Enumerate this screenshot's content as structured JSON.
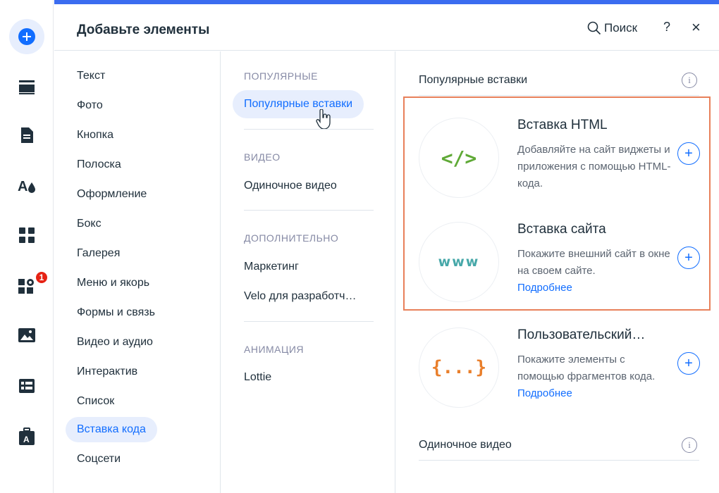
{
  "header": {
    "title": "Добавьте элементы",
    "search_label": "Поиск",
    "help_label": "?",
    "close_label": "×"
  },
  "rail": {
    "notification_count": "1",
    "icons": [
      "add-icon",
      "strip-icon",
      "page-icon",
      "theme-icon",
      "apps-grid-icon",
      "extensions-icon",
      "media-icon",
      "cms-icon",
      "portfolio-icon"
    ]
  },
  "categories": [
    {
      "label": "Текст"
    },
    {
      "label": "Фото"
    },
    {
      "label": "Кнопка"
    },
    {
      "label": "Полоска"
    },
    {
      "label": "Оформление"
    },
    {
      "label": "Бокс"
    },
    {
      "label": "Галерея"
    },
    {
      "label": "Меню и якорь"
    },
    {
      "label": "Формы и связь"
    },
    {
      "label": "Видео и аудио"
    },
    {
      "label": "Интерактив"
    },
    {
      "label": "Список"
    },
    {
      "label": "Вставка кода",
      "active": true
    },
    {
      "label": "Соцсети"
    }
  ],
  "subcategories": {
    "popular_heading": "ПОПУЛЯРНЫЕ",
    "popular_item": "Популярные вставки",
    "video_heading": "ВИДЕО",
    "video_item": "Одиночное видео",
    "extra_heading": "ДОПОЛНИТЕЛЬНО",
    "extra_item_1": "Маркетинг",
    "extra_item_2": "Velo для разработч…",
    "animation_heading": "АНИМАЦИЯ",
    "animation_item": "Lottie"
  },
  "content": {
    "section_title": "Популярные вставки",
    "section_title_2": "Одиночное видео",
    "cards": [
      {
        "icon_text": "</>",
        "title": "Вставка HTML",
        "description": "Добавляйте на сайт виджеты и приложения с помощью HTML-кода.",
        "link": ""
      },
      {
        "icon_text": "www",
        "title": "Вставка сайта",
        "description": "Покажите внешний сайт в окне на своем сайте.",
        "link": "Подробнее"
      },
      {
        "icon_text": "{...}",
        "title": "Пользовательский…",
        "description": "Покажите элементы с помощью фрагментов кода.",
        "link": "Подробнее"
      }
    ]
  },
  "colors": {
    "accent": "#116dff",
    "accent_bg": "#e7eefd",
    "highlight_border": "#e8805a",
    "badge": "#e62214",
    "code_icon": "#5fa936",
    "www_icon": "#47a8a9",
    "brace_icon": "#e97f2c"
  }
}
